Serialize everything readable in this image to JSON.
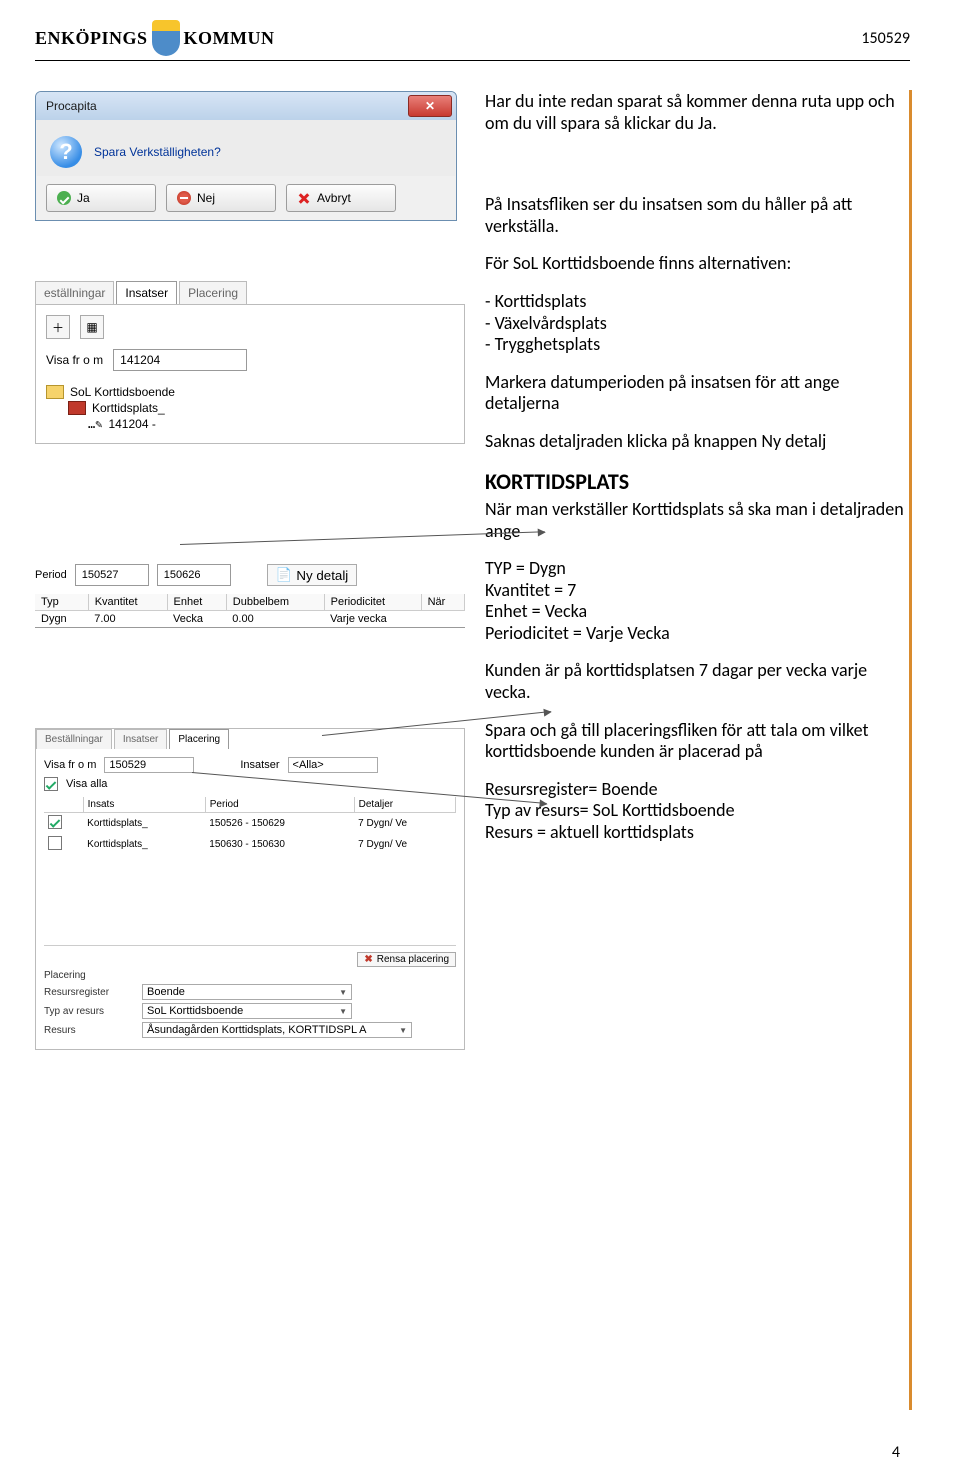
{
  "header": {
    "logo_left": "ENKÖPINGS",
    "logo_right": "KOMMUN",
    "doc_date": "150529"
  },
  "dialog": {
    "title": "Procapita",
    "question": "Spara Verkställigheten?",
    "btn_yes": "Ja",
    "btn_no": "Nej",
    "btn_cancel": "Avbryt"
  },
  "tabs_panel": {
    "tab1": "eställningar",
    "tab2": "Insatser",
    "tab3": "Placering",
    "visa_label": "Visa fr o m",
    "visa_value": "141204",
    "tree_root": "SoL Korttidsboende",
    "tree_child": "Korttidsplats_",
    "tree_leaf": "141204 -"
  },
  "period": {
    "label": "Period",
    "from": "150527",
    "to": "150626",
    "new_detail_btn": "Ny detalj",
    "headers": [
      "Typ",
      "Kvantitet",
      "Enhet",
      "Dubbelbem",
      "Periodicitet",
      "När"
    ],
    "row": [
      "Dygn",
      "7.00",
      "Vecka",
      "0.00",
      "Varje vecka",
      ""
    ]
  },
  "plac": {
    "tab1": "Beställningar",
    "tab2": "Insatser",
    "tab3": "Placering",
    "visa_label": "Visa fr o m",
    "visa_value": "150529",
    "insatser_label": "Insatser",
    "insatser_value": "<Alla>",
    "visa_alla": "Visa alla",
    "th": [
      "",
      "Insats",
      "Period",
      "Detaljer"
    ],
    "rows": [
      {
        "checked": true,
        "insats": "Korttidsplats_",
        "period": "150526 - 150629",
        "detaljer": "7 Dygn/ Ve"
      },
      {
        "checked": false,
        "insats": "Korttidsplats_",
        "period": "150630 - 150630",
        "detaljer": "7 Dygn/ Ve"
      }
    ],
    "rensa_btn": "Rensa placering",
    "bottom": {
      "placering_lbl": "Placering",
      "resursreg_lbl": "Resursregister",
      "resursreg_val": "Boende",
      "typ_lbl": "Typ av resurs",
      "typ_val": "SoL Korttidsboende",
      "resurs_lbl": "Resurs",
      "resurs_val": "Åsundagården Korttidsplats, KORTTIDSPL A"
    }
  },
  "right": {
    "p1": "Har du inte redan sparat så kommer denna ruta upp och om du vill spara så klickar du Ja.",
    "p2": "På Insatsfliken ser du insatsen som du håller på att verkställa.",
    "p3": "För SoL Korttidsboende finns alternativen:",
    "li1": "- Korttidsplats",
    "li2": "- Växelvårdsplats",
    "li3": "- Trygghetsplats",
    "p4": "Markera datumperioden på insatsen för att ange detaljerna",
    "p5": "Saknas detaljraden klicka på knappen Ny detalj",
    "h2": "KORTTIDSPLATS",
    "p6": "När man verkställer Korttidsplats så ska man i detaljraden ange",
    "p7a": "TYP = Dygn",
    "p7b": "Kvantitet = 7",
    "p7c": "Enhet = Vecka",
    "p7d": "Periodicitet = Varje Vecka",
    "p8": "Kunden är på korttidsplatsen 7 dagar per vecka varje vecka.",
    "p9": "Spara och gå till placeringsfliken för att tala om vilket korttidsboende kunden är placerad på",
    "p10a": "Resursregister= Boende",
    "p10b": "Typ av resurs= SoL Korttidsboende",
    "p10c": "Resurs = aktuell korttidsplats"
  },
  "pagenum": "4"
}
